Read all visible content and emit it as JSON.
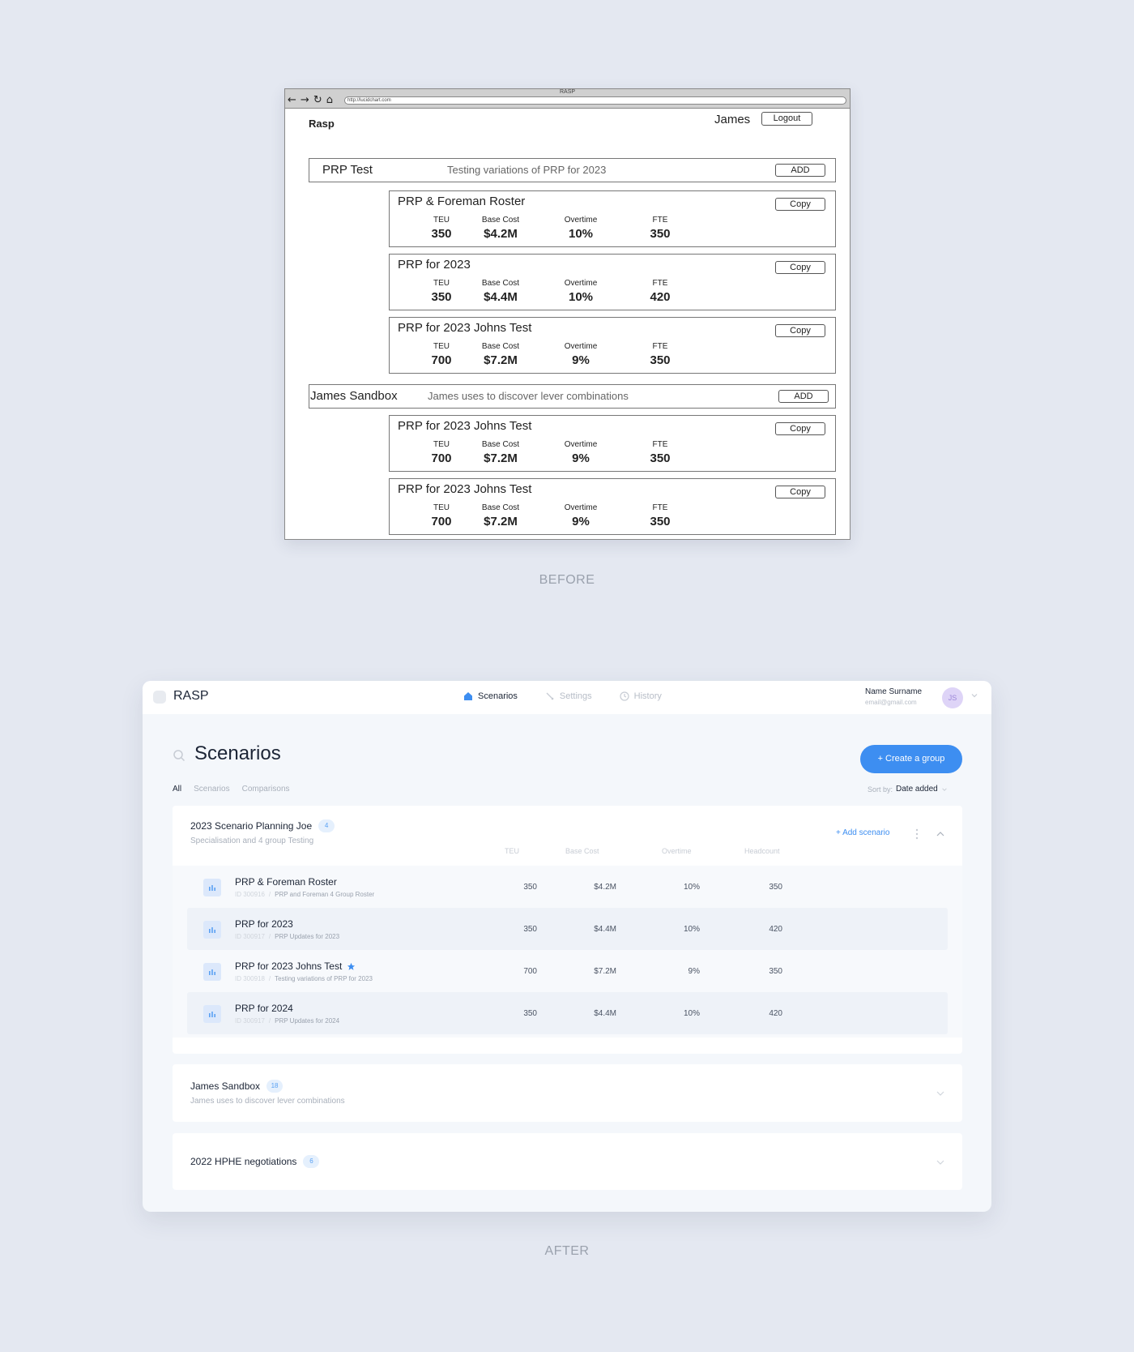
{
  "before": {
    "caption": "BEFORE",
    "browser": {
      "title": "RASP",
      "url": "http://lucidchart.com",
      "nav_icons": [
        "back-arrow-icon",
        "forward-arrow-icon",
        "reload-icon",
        "home-icon"
      ]
    },
    "logo": "Rasp",
    "user": "James",
    "logout_label": "Logout",
    "metric_labels": [
      "TEU",
      "Base Cost",
      "Overtime",
      "FTE"
    ],
    "groups": [
      {
        "name": "PRP Test",
        "description": "Testing variations of PRP for 2023",
        "add_label": "ADD",
        "cards": [
          {
            "title": "PRP & Foreman Roster",
            "copy_label": "Copy",
            "values": [
              "350",
              "$4.2M",
              "10%",
              "350"
            ]
          },
          {
            "title": "PRP for 2023",
            "copy_label": "Copy",
            "values": [
              "350",
              "$4.4M",
              "10%",
              "420"
            ]
          },
          {
            "title": "PRP for 2023 Johns Test",
            "copy_label": "Copy",
            "values": [
              "700",
              "$7.2M",
              "9%",
              "350"
            ]
          }
        ]
      },
      {
        "name": "James Sandbox",
        "description": "James uses to discover lever combinations",
        "add_label": "ADD",
        "cards": [
          {
            "title": "PRP for 2023 Johns Test",
            "copy_label": "Copy",
            "values": [
              "700",
              "$7.2M",
              "9%",
              "350"
            ]
          },
          {
            "title": "PRP for 2023 Johns Test",
            "copy_label": "Copy",
            "values": [
              "700",
              "$7.2M",
              "9%",
              "350"
            ]
          }
        ]
      }
    ]
  },
  "after": {
    "caption": "AFTER",
    "brand": "RASP",
    "nav": [
      {
        "label": "Scenarios",
        "icon": "home-icon",
        "active": true
      },
      {
        "label": "Settings",
        "icon": "settings-icon",
        "active": false
      },
      {
        "label": "History",
        "icon": "clock-icon",
        "active": false
      }
    ],
    "user": {
      "name": "Name Surname",
      "email": "email@gmail.com",
      "initials": "JS"
    },
    "page_title": "Scenarios",
    "create_button": "+ Create a group",
    "filters": [
      "All",
      "Scenarios",
      "Comparisons"
    ],
    "sort": {
      "label": "Sort by:",
      "value": "Date added"
    },
    "columns": [
      "TEU",
      "Base Cost",
      "Overtime",
      "Headcount"
    ],
    "colors": {
      "accent": "#3d8ef1",
      "background": "#e4e8f1",
      "star": "#3d8ef1"
    },
    "groups": [
      {
        "name": "2023 Scenario Planning Joe",
        "count": "4",
        "description": "Specialisation and 4 group Testing",
        "add_scenario": "+ Add scenario",
        "expanded": true,
        "rows": [
          {
            "name": "PRP & Foreman Roster",
            "id": "ID 300916",
            "desc": "PRP and Foreman 4 Group Roster",
            "starred": false,
            "values": [
              "350",
              "$4.2M",
              "10%",
              "350"
            ]
          },
          {
            "name": "PRP for 2023",
            "id": "ID 300917",
            "desc": "PRP Updates for 2023",
            "starred": false,
            "values": [
              "350",
              "$4.4M",
              "10%",
              "420"
            ]
          },
          {
            "name": "PRP for 2023 Johns Test",
            "id": "ID 300918",
            "desc": "Testing variations of PRP for 2023",
            "starred": true,
            "values": [
              "700",
              "$7.2M",
              "9%",
              "350"
            ]
          },
          {
            "name": "PRP for 2024",
            "id": "ID 300917",
            "desc": "PRP Updates for 2024",
            "starred": false,
            "values": [
              "350",
              "$4.4M",
              "10%",
              "420"
            ]
          }
        ]
      },
      {
        "name": "James Sandbox",
        "count": "18",
        "description": "James uses to discover lever combinations",
        "expanded": false
      },
      {
        "name": "2022 HPHE negotiations",
        "count": "6",
        "description": "",
        "expanded": false
      }
    ]
  }
}
